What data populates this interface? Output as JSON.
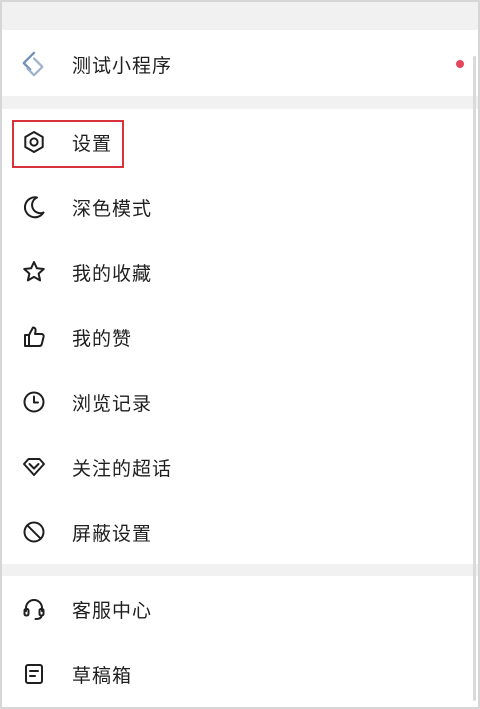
{
  "menu": {
    "mini_program": {
      "label": "测试小程序",
      "icon": "mini-program-logo-icon",
      "badge_color": "#e5445c"
    },
    "items": [
      {
        "label": "设置",
        "icon": "settings-icon"
      },
      {
        "label": "深色模式",
        "icon": "moon-icon"
      },
      {
        "label": "我的收藏",
        "icon": "star-icon"
      },
      {
        "label": "我的赞",
        "icon": "thumbs-up-icon"
      },
      {
        "label": "浏览记录",
        "icon": "clock-icon"
      },
      {
        "label": "关注的超话",
        "icon": "diamond-icon"
      },
      {
        "label": "屏蔽设置",
        "icon": "block-icon"
      }
    ],
    "footer_items": [
      {
        "label": "客服中心",
        "icon": "headset-icon"
      },
      {
        "label": "草稿箱",
        "icon": "drafts-icon"
      }
    ]
  },
  "colors": {
    "highlight_border": "#d9323b",
    "separator": "#f1f1f1",
    "logo_blue": "#6f8fb8"
  }
}
